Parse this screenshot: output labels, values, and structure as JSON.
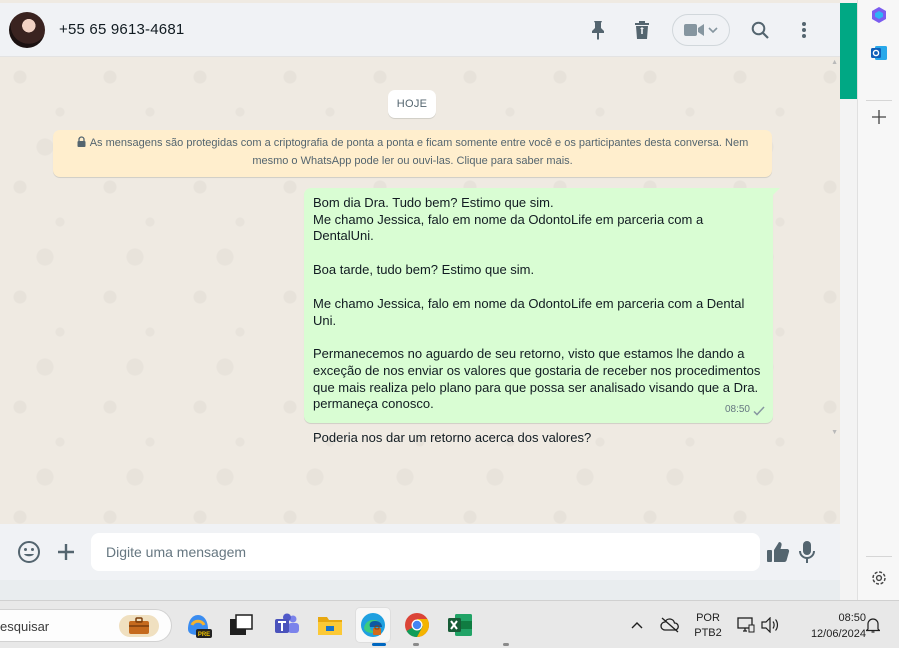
{
  "header": {
    "contact_name": "+55 65 9613-4681",
    "icons": [
      "pin-icon",
      "delete-icon",
      "video-call-icon",
      "chevron-down-icon",
      "search-icon",
      "menu-dots-icon"
    ]
  },
  "chat": {
    "date_chip": "HOJE",
    "encryption_notice": "As mensagens são protegidas com a criptografia de ponta a ponta e ficam somente entre você e os participantes desta conversa. Nem mesmo o WhatsApp pode ler ou ouvi-las. Clique para saber mais.",
    "message": {
      "paragraphs": [
        "Bom dia Dra. Tudo bem? Estimo que sim.\nMe chamo Jessica, falo em nome da OdontoLife em parceria com a DentalUni.",
        "Boa tarde, tudo bem? Estimo que sim.",
        "Me chamo Jessica, falo em nome da OdontoLife em parceria com a Dental Uni.",
        "Permanecemos no aguardo de seu retorno, visto que estamos lhe dando a exceção de nos enviar os valores que gostaria de receber nos procedimentos que mais realiza pelo plano para que possa ser analisado visando que a Dra. permaneça conosco.",
        "Poderia nos dar um retorno acerca dos valores?"
      ],
      "time": "08:50",
      "status": "sent"
    }
  },
  "composer": {
    "placeholder": "Digite uma mensagem"
  },
  "taskbar": {
    "search_text": "esquisar",
    "language_line1": "POR",
    "language_line2": "PTB2",
    "time": "08:50",
    "date": "12/06/2024",
    "copilot_badge": "PRE"
  },
  "colors": {
    "accent": "#00a884",
    "outgoing_bubble": "#d9fdd3",
    "notice_bg": "#ffeecd",
    "chat_bg": "#efeae2"
  }
}
